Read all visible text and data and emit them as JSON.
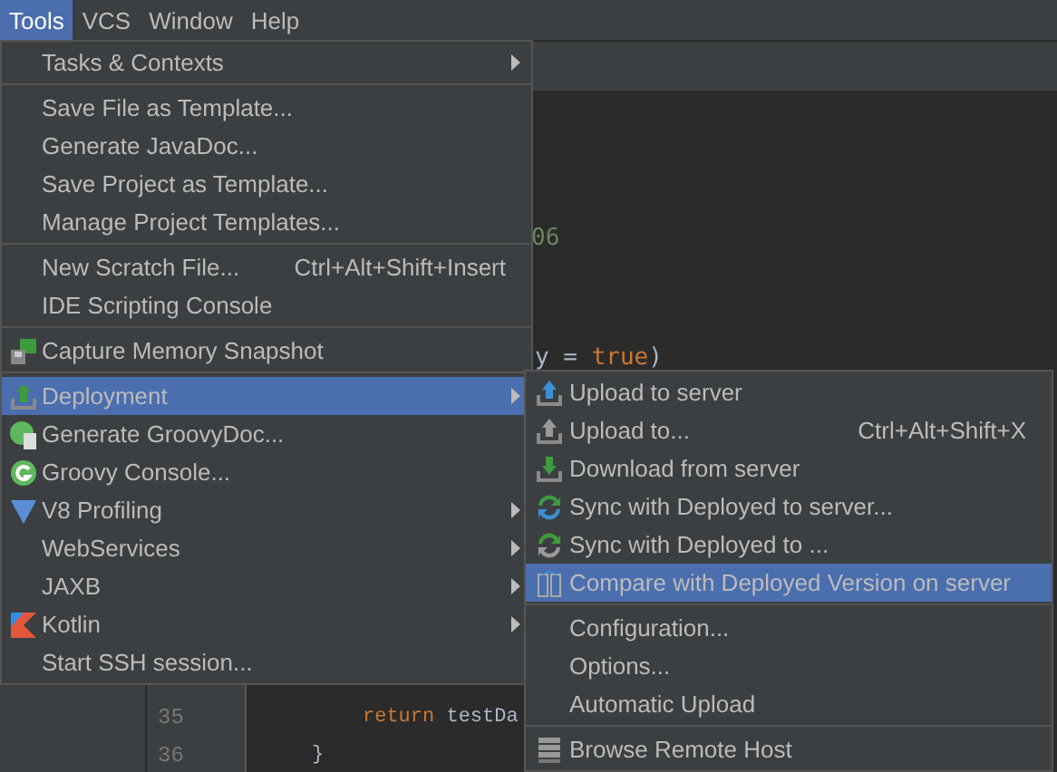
{
  "menubar": [
    {
      "label": "Tools",
      "selected": true
    },
    {
      "label": "VCS",
      "selected": false
    },
    {
      "label": "Window",
      "selected": false
    },
    {
      "label": "Help",
      "selected": false
    }
  ],
  "editor": {
    "fragments": [
      {
        "text": "06",
        "kind": "string"
      },
      {
        "text": "y = ",
        "kind": "plain"
      },
      {
        "text": "true",
        "kind": "keyword"
      },
      {
        "text": ")",
        "kind": "plain"
      }
    ],
    "lines": [
      {
        "number": "35",
        "code": [
          {
            "text": "return ",
            "kind": "keyword"
          },
          {
            "text": "testDa",
            "kind": "plain"
          }
        ]
      },
      {
        "number": "36",
        "code": [
          {
            "text": "}",
            "kind": "plain"
          }
        ]
      }
    ]
  },
  "tools_menu": [
    {
      "label": "Tasks & Contexts",
      "submenu": true,
      "selected": false,
      "kind": "plain"
    },
    {
      "label": "Save File as Template...",
      "submenu": false,
      "selected": false,
      "kind": "plain",
      "separator_before": true
    },
    {
      "label": "Generate JavaDoc...",
      "submenu": false,
      "selected": false,
      "kind": "plain"
    },
    {
      "label": "Save Project as Template...",
      "submenu": false,
      "selected": false,
      "kind": "plain"
    },
    {
      "label": "Manage Project Templates...",
      "submenu": false,
      "selected": false,
      "kind": "plain"
    },
    {
      "label": "New Scratch File...",
      "shortcut": "Ctrl+Alt+Shift+Insert",
      "submenu": false,
      "selected": false,
      "kind": "plain",
      "separator_before": true
    },
    {
      "label": "IDE Scripting Console",
      "submenu": false,
      "selected": false,
      "kind": "plain"
    },
    {
      "label": "Capture Memory Snapshot",
      "submenu": false,
      "selected": false,
      "kind": "memory",
      "separator_before": true
    },
    {
      "label": "Deployment",
      "submenu": true,
      "selected": true,
      "kind": "deploy",
      "separator_before": true
    },
    {
      "label": "Generate GroovyDoc...",
      "submenu": false,
      "selected": false,
      "kind": "groovydoc"
    },
    {
      "label": "Groovy Console...",
      "submenu": false,
      "selected": false,
      "kind": "groovy"
    },
    {
      "label": "V8 Profiling",
      "submenu": true,
      "selected": false,
      "kind": "v8"
    },
    {
      "label": "WebServices",
      "submenu": true,
      "selected": false,
      "kind": "plain"
    },
    {
      "label": "JAXB",
      "submenu": true,
      "selected": false,
      "kind": "plain"
    },
    {
      "label": "Kotlin",
      "submenu": true,
      "selected": false,
      "kind": "kotlin"
    },
    {
      "label": "Start SSH session...",
      "submenu": false,
      "selected": false,
      "kind": "plain"
    }
  ],
  "deployment_menu": [
    {
      "label": "Upload to server",
      "selected": false,
      "kind": "upload"
    },
    {
      "label": "Upload to...",
      "shortcut": "Ctrl+Alt+Shift+X",
      "selected": false,
      "kind": "upload-gray"
    },
    {
      "label": "Download from server",
      "selected": false,
      "kind": "download"
    },
    {
      "label": "Sync with Deployed to server...",
      "selected": false,
      "kind": "sync"
    },
    {
      "label": "Sync with Deployed to ...",
      "selected": false,
      "kind": "sync-gray"
    },
    {
      "label": "Compare with Deployed Version on server",
      "selected": true,
      "kind": "compare"
    },
    {
      "label": "Configuration...",
      "selected": false,
      "kind": "plain",
      "separator_before": true
    },
    {
      "label": "Options...",
      "selected": false,
      "kind": "plain"
    },
    {
      "label": "Automatic Upload",
      "selected": false,
      "kind": "plain"
    },
    {
      "label": "Browse Remote Host",
      "selected": false,
      "kind": "server",
      "separator_before": true
    }
  ]
}
